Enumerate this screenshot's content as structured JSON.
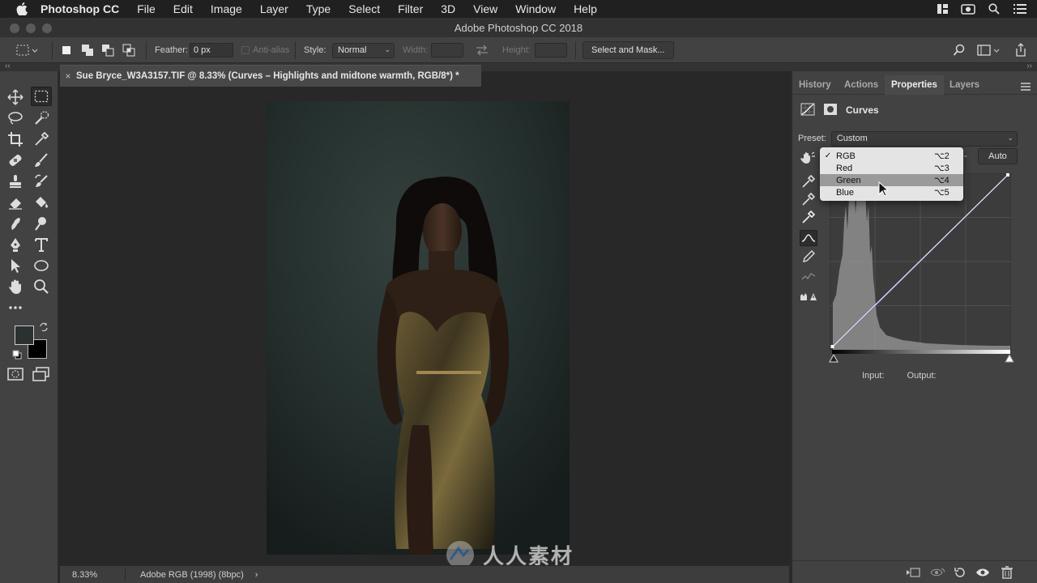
{
  "menubar": {
    "app": "Photoshop CC",
    "items": [
      "File",
      "Edit",
      "Image",
      "Layer",
      "Type",
      "Select",
      "Filter",
      "3D",
      "View",
      "Window",
      "Help"
    ]
  },
  "window": {
    "title": "Adobe Photoshop CC 2018"
  },
  "options": {
    "feather_label": "Feather:",
    "feather_value": "0 px",
    "antialias_label": "Anti-alias",
    "style_label": "Style:",
    "style_value": "Normal",
    "width_label": "Width:",
    "height_label": "Height:",
    "select_mask_label": "Select and Mask..."
  },
  "document": {
    "tab_title": "Sue Bryce_W3A3157.TIF @ 8.33% (Curves – Highlights and midtone warmth, RGB/8*) *",
    "zoom": "8.33%",
    "profile": "Adobe RGB (1998) (8bpc)",
    "status_arrow": "›"
  },
  "watermark": {
    "text": "人人素材"
  },
  "panel": {
    "tabs": [
      "History",
      "Actions",
      "Properties",
      "Layers"
    ],
    "active_tab": "Properties",
    "title": "Curves",
    "preset_label": "Preset:",
    "preset_value": "Custom",
    "auto_label": "Auto",
    "input_label": "Input:",
    "output_label": "Output:"
  },
  "channel_menu": {
    "items": [
      {
        "label": "RGB",
        "shortcut": "⌥2",
        "checked": "✓"
      },
      {
        "label": "Red",
        "shortcut": "⌥3",
        "checked": ""
      },
      {
        "label": "Green",
        "shortcut": "⌥4",
        "checked": ""
      },
      {
        "label": "Blue",
        "shortcut": "⌥5",
        "checked": ""
      }
    ],
    "highlighted": "Green"
  },
  "colors": {
    "curve_line": "#ffffff",
    "channel_line": "#5a5ad0",
    "foreground": "#2b3030",
    "background": "#000000"
  }
}
